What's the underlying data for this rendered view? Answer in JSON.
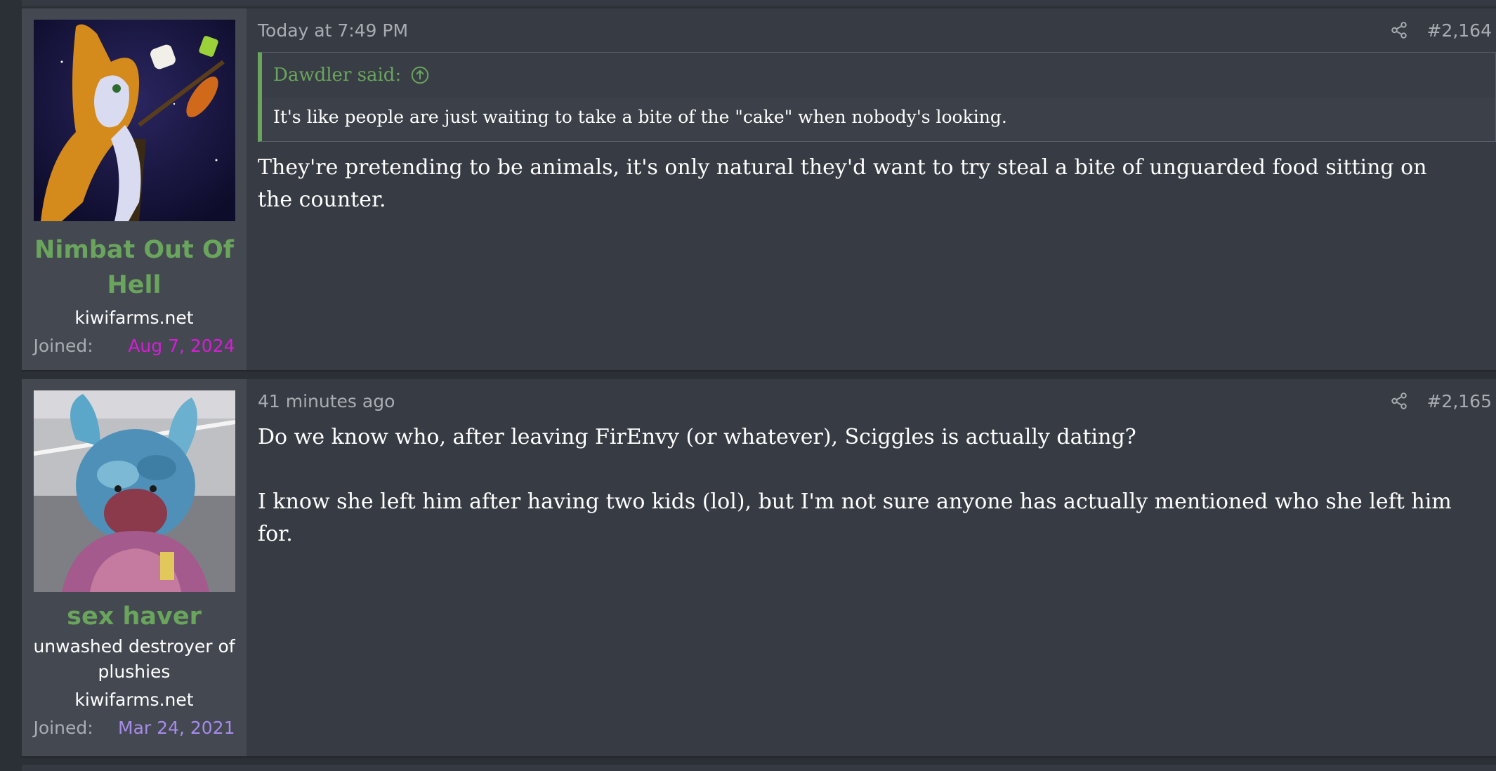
{
  "posts": [
    {
      "user": {
        "name": "Nimbat Out Of Hell",
        "site": "kiwifarms.net",
        "joined_label": "Joined:",
        "joined_date": "Aug 7, 2024"
      },
      "timestamp": "Today at 7:49 PM",
      "post_number": "#2,164",
      "quote": {
        "author": "Dawdler said:",
        "text": "It's like people are just waiting to take a bite of the \"cake\" when nobody's looking."
      },
      "body": [
        "They're pretending to be animals, it's only natural they'd want to try steal a bite of unguarded food sitting on the counter."
      ]
    },
    {
      "user": {
        "name": "sex haver",
        "title": "unwashed destroyer of plushies",
        "site": "kiwifarms.net",
        "joined_label": "Joined:",
        "joined_date": "Mar 24, 2021"
      },
      "timestamp": "41 minutes ago",
      "post_number": "#2,165",
      "body": [
        "Do we know who, after leaving FirEnvy (or whatever), Sciggles is actually dating?",
        "I know she left him after having two kids (lol), but I'm not sure anyone has actually mentioned who she left him for."
      ]
    }
  ],
  "icons": {
    "share": "share-icon",
    "jump": "arrow-up-circle-icon"
  },
  "colors": {
    "background": "#2b2f36",
    "post_bg": "#373b43",
    "user_panel_bg": "#444851",
    "username": "#6aa55d",
    "quote_accent": "#6aa55d",
    "joined_date_1": "#d61ed6",
    "joined_date_2": "#a68bea",
    "muted_text": "#a9adb3"
  }
}
